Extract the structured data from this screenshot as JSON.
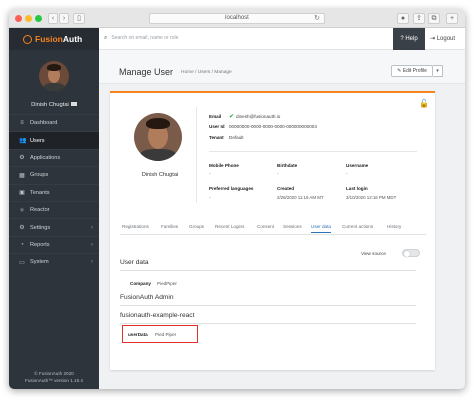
{
  "browser": {
    "url": "localhost",
    "reload_icon": "reload-icon"
  },
  "sidebar": {
    "brand_a": "Fusion",
    "brand_b": "Auth",
    "user_name": "Dinish Chugtai",
    "items": [
      {
        "label": "Dashboard",
        "icon": "≡",
        "chevron": ""
      },
      {
        "label": "Users",
        "icon": "👥",
        "chevron": ""
      },
      {
        "label": "Applications",
        "icon": "⚙",
        "chevron": ""
      },
      {
        "label": "Groups",
        "icon": "▦",
        "chevron": ""
      },
      {
        "label": "Tenants",
        "icon": "▣",
        "chevron": ""
      },
      {
        "label": "Reactor",
        "icon": "⚛",
        "chevron": ""
      },
      {
        "label": "Settings",
        "icon": "⚙",
        "chevron": "‹"
      },
      {
        "label": "Reports",
        "icon": "◔",
        "chevron": "‹"
      },
      {
        "label": "System",
        "icon": "▭",
        "chevron": "‹"
      }
    ],
    "footer_line1": "© FusionAuth 2020",
    "footer_line2": "FusionAuth™ version 1.15.4"
  },
  "topbar": {
    "search_placeholder": "Search on email, name or role",
    "help_label": "Help",
    "logout_label": "Logout"
  },
  "header": {
    "title": "Manage User",
    "breadcrumb": "Home  /  Users  /  Manage",
    "edit_label": "Edit Profile",
    "caret": "▾"
  },
  "user": {
    "name": "Dinish Chugtai",
    "email_label": "Email",
    "email": "dinesh@fusionauth.io",
    "userid_label": "User Id",
    "userid": "00000000-0000-0000-0000-000000000004",
    "tenant_label": "Tenant",
    "tenant": "Default",
    "mobile_label": "Mobile Phone",
    "mobile": "-",
    "birthdate_label": "Birthdate",
    "birthdate": "-",
    "username_label": "Username",
    "username": "-",
    "lang_label": "Preferred languages",
    "lang": "-",
    "created_label": "Created",
    "created": "2/28/2020 11:16 AM MT",
    "lastlogin_label": "Last login",
    "lastlogin": "3/10/2020 12:16 PM MDT"
  },
  "tabs": [
    "Registrations",
    "Families",
    "Groups",
    "Recent Logins",
    "Consent",
    "Sessions",
    "User data",
    "Current actions",
    "History"
  ],
  "userdata": {
    "section_title": "User data",
    "view_source": "View source",
    "company_label": "Company",
    "company": "PiedPiper",
    "admin_title": "FusionAuth Admin",
    "app_title": "fusionauth-example-react",
    "userdata_label": "userData",
    "userdata_value": "Pied Piper"
  }
}
